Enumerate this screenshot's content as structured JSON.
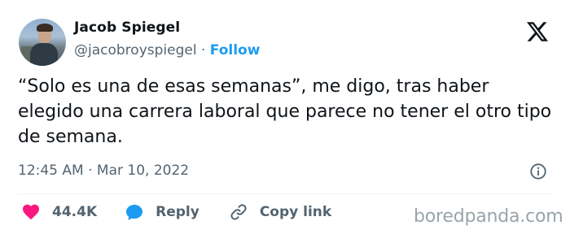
{
  "author": {
    "name": "Jacob Spiegel",
    "handle": "@jacobroyspiegel",
    "separator": "·",
    "follow_label": "Follow"
  },
  "tweet": {
    "text": "“Solo es una de esas semanas”, me digo, tras haber elegido una carrera laboral que parece no tener el otro tipo de semana.",
    "timestamp": "12:45 AM · Mar 10, 2022"
  },
  "actions": {
    "likes": "44.4K",
    "reply_label": "Reply",
    "copy_link_label": "Copy link"
  },
  "watermark": "boredpanda.com",
  "colors": {
    "accent": "#1d9bf0",
    "like": "#f91880",
    "text_primary": "#0f1419",
    "text_secondary": "#536471"
  },
  "icons": {
    "platform": "x-logo-icon",
    "info": "info-icon",
    "like": "heart-icon",
    "reply": "speech-bubble-icon",
    "copy": "link-icon"
  }
}
